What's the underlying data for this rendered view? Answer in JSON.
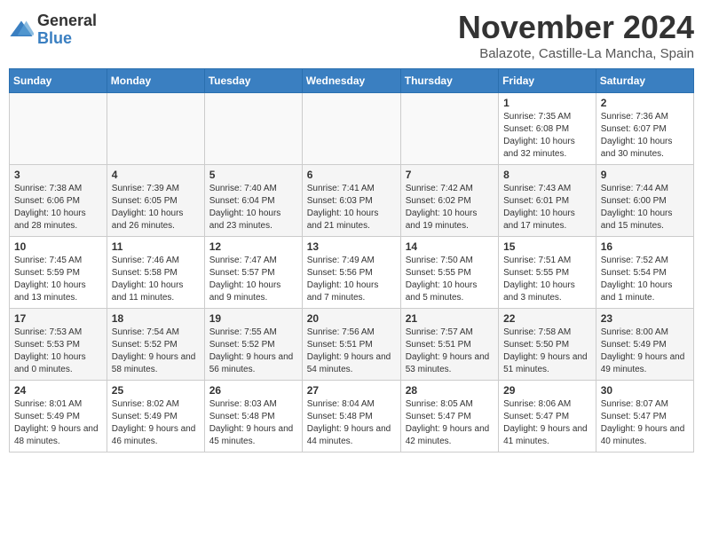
{
  "logo": {
    "general": "General",
    "blue": "Blue"
  },
  "header": {
    "month": "November 2024",
    "location": "Balazote, Castille-La Mancha, Spain"
  },
  "weekdays": [
    "Sunday",
    "Monday",
    "Tuesday",
    "Wednesday",
    "Thursday",
    "Friday",
    "Saturday"
  ],
  "weeks": [
    [
      {
        "day": "",
        "info": ""
      },
      {
        "day": "",
        "info": ""
      },
      {
        "day": "",
        "info": ""
      },
      {
        "day": "",
        "info": ""
      },
      {
        "day": "",
        "info": ""
      },
      {
        "day": "1",
        "info": "Sunrise: 7:35 AM\nSunset: 6:08 PM\nDaylight: 10 hours and 32 minutes."
      },
      {
        "day": "2",
        "info": "Sunrise: 7:36 AM\nSunset: 6:07 PM\nDaylight: 10 hours and 30 minutes."
      }
    ],
    [
      {
        "day": "3",
        "info": "Sunrise: 7:38 AM\nSunset: 6:06 PM\nDaylight: 10 hours and 28 minutes."
      },
      {
        "day": "4",
        "info": "Sunrise: 7:39 AM\nSunset: 6:05 PM\nDaylight: 10 hours and 26 minutes."
      },
      {
        "day": "5",
        "info": "Sunrise: 7:40 AM\nSunset: 6:04 PM\nDaylight: 10 hours and 23 minutes."
      },
      {
        "day": "6",
        "info": "Sunrise: 7:41 AM\nSunset: 6:03 PM\nDaylight: 10 hours and 21 minutes."
      },
      {
        "day": "7",
        "info": "Sunrise: 7:42 AM\nSunset: 6:02 PM\nDaylight: 10 hours and 19 minutes."
      },
      {
        "day": "8",
        "info": "Sunrise: 7:43 AM\nSunset: 6:01 PM\nDaylight: 10 hours and 17 minutes."
      },
      {
        "day": "9",
        "info": "Sunrise: 7:44 AM\nSunset: 6:00 PM\nDaylight: 10 hours and 15 minutes."
      }
    ],
    [
      {
        "day": "10",
        "info": "Sunrise: 7:45 AM\nSunset: 5:59 PM\nDaylight: 10 hours and 13 minutes."
      },
      {
        "day": "11",
        "info": "Sunrise: 7:46 AM\nSunset: 5:58 PM\nDaylight: 10 hours and 11 minutes."
      },
      {
        "day": "12",
        "info": "Sunrise: 7:47 AM\nSunset: 5:57 PM\nDaylight: 10 hours and 9 minutes."
      },
      {
        "day": "13",
        "info": "Sunrise: 7:49 AM\nSunset: 5:56 PM\nDaylight: 10 hours and 7 minutes."
      },
      {
        "day": "14",
        "info": "Sunrise: 7:50 AM\nSunset: 5:55 PM\nDaylight: 10 hours and 5 minutes."
      },
      {
        "day": "15",
        "info": "Sunrise: 7:51 AM\nSunset: 5:55 PM\nDaylight: 10 hours and 3 minutes."
      },
      {
        "day": "16",
        "info": "Sunrise: 7:52 AM\nSunset: 5:54 PM\nDaylight: 10 hours and 1 minute."
      }
    ],
    [
      {
        "day": "17",
        "info": "Sunrise: 7:53 AM\nSunset: 5:53 PM\nDaylight: 10 hours and 0 minutes."
      },
      {
        "day": "18",
        "info": "Sunrise: 7:54 AM\nSunset: 5:52 PM\nDaylight: 9 hours and 58 minutes."
      },
      {
        "day": "19",
        "info": "Sunrise: 7:55 AM\nSunset: 5:52 PM\nDaylight: 9 hours and 56 minutes."
      },
      {
        "day": "20",
        "info": "Sunrise: 7:56 AM\nSunset: 5:51 PM\nDaylight: 9 hours and 54 minutes."
      },
      {
        "day": "21",
        "info": "Sunrise: 7:57 AM\nSunset: 5:51 PM\nDaylight: 9 hours and 53 minutes."
      },
      {
        "day": "22",
        "info": "Sunrise: 7:58 AM\nSunset: 5:50 PM\nDaylight: 9 hours and 51 minutes."
      },
      {
        "day": "23",
        "info": "Sunrise: 8:00 AM\nSunset: 5:49 PM\nDaylight: 9 hours and 49 minutes."
      }
    ],
    [
      {
        "day": "24",
        "info": "Sunrise: 8:01 AM\nSunset: 5:49 PM\nDaylight: 9 hours and 48 minutes."
      },
      {
        "day": "25",
        "info": "Sunrise: 8:02 AM\nSunset: 5:49 PM\nDaylight: 9 hours and 46 minutes."
      },
      {
        "day": "26",
        "info": "Sunrise: 8:03 AM\nSunset: 5:48 PM\nDaylight: 9 hours and 45 minutes."
      },
      {
        "day": "27",
        "info": "Sunrise: 8:04 AM\nSunset: 5:48 PM\nDaylight: 9 hours and 44 minutes."
      },
      {
        "day": "28",
        "info": "Sunrise: 8:05 AM\nSunset: 5:47 PM\nDaylight: 9 hours and 42 minutes."
      },
      {
        "day": "29",
        "info": "Sunrise: 8:06 AM\nSunset: 5:47 PM\nDaylight: 9 hours and 41 minutes."
      },
      {
        "day": "30",
        "info": "Sunrise: 8:07 AM\nSunset: 5:47 PM\nDaylight: 9 hours and 40 minutes."
      }
    ]
  ]
}
